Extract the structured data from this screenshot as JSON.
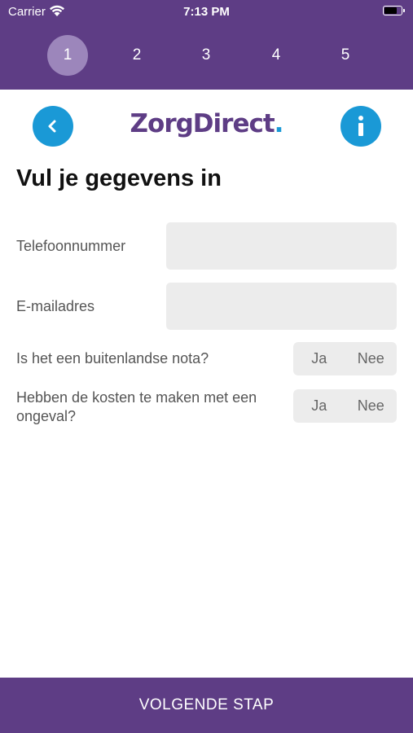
{
  "status_bar": {
    "carrier": "Carrier",
    "time": "7:13 PM"
  },
  "steps": {
    "items": [
      "1",
      "2",
      "3",
      "4",
      "5"
    ],
    "active": 1
  },
  "header": {
    "logo_text": "ZorgDirect",
    "logo_dot": ".",
    "back_icon": "chevron-left-icon",
    "info_icon": "info-icon",
    "accent_color": "#1a99d6",
    "brand_color": "#5e3d85"
  },
  "page": {
    "title": "Vul je gegevens in"
  },
  "form": {
    "phone": {
      "label": "Telefoonnummer",
      "value": ""
    },
    "email": {
      "label": "E-mailadres",
      "value": ""
    },
    "foreign_bill": {
      "label": "Is het een buitenlandse nota?",
      "yes": "Ja",
      "no": "Nee"
    },
    "accident": {
      "label": "Hebben de kosten te maken met een ongeval?",
      "yes": "Ja",
      "no": "Nee"
    }
  },
  "footer": {
    "next_label": "VOLGENDE STAP"
  }
}
